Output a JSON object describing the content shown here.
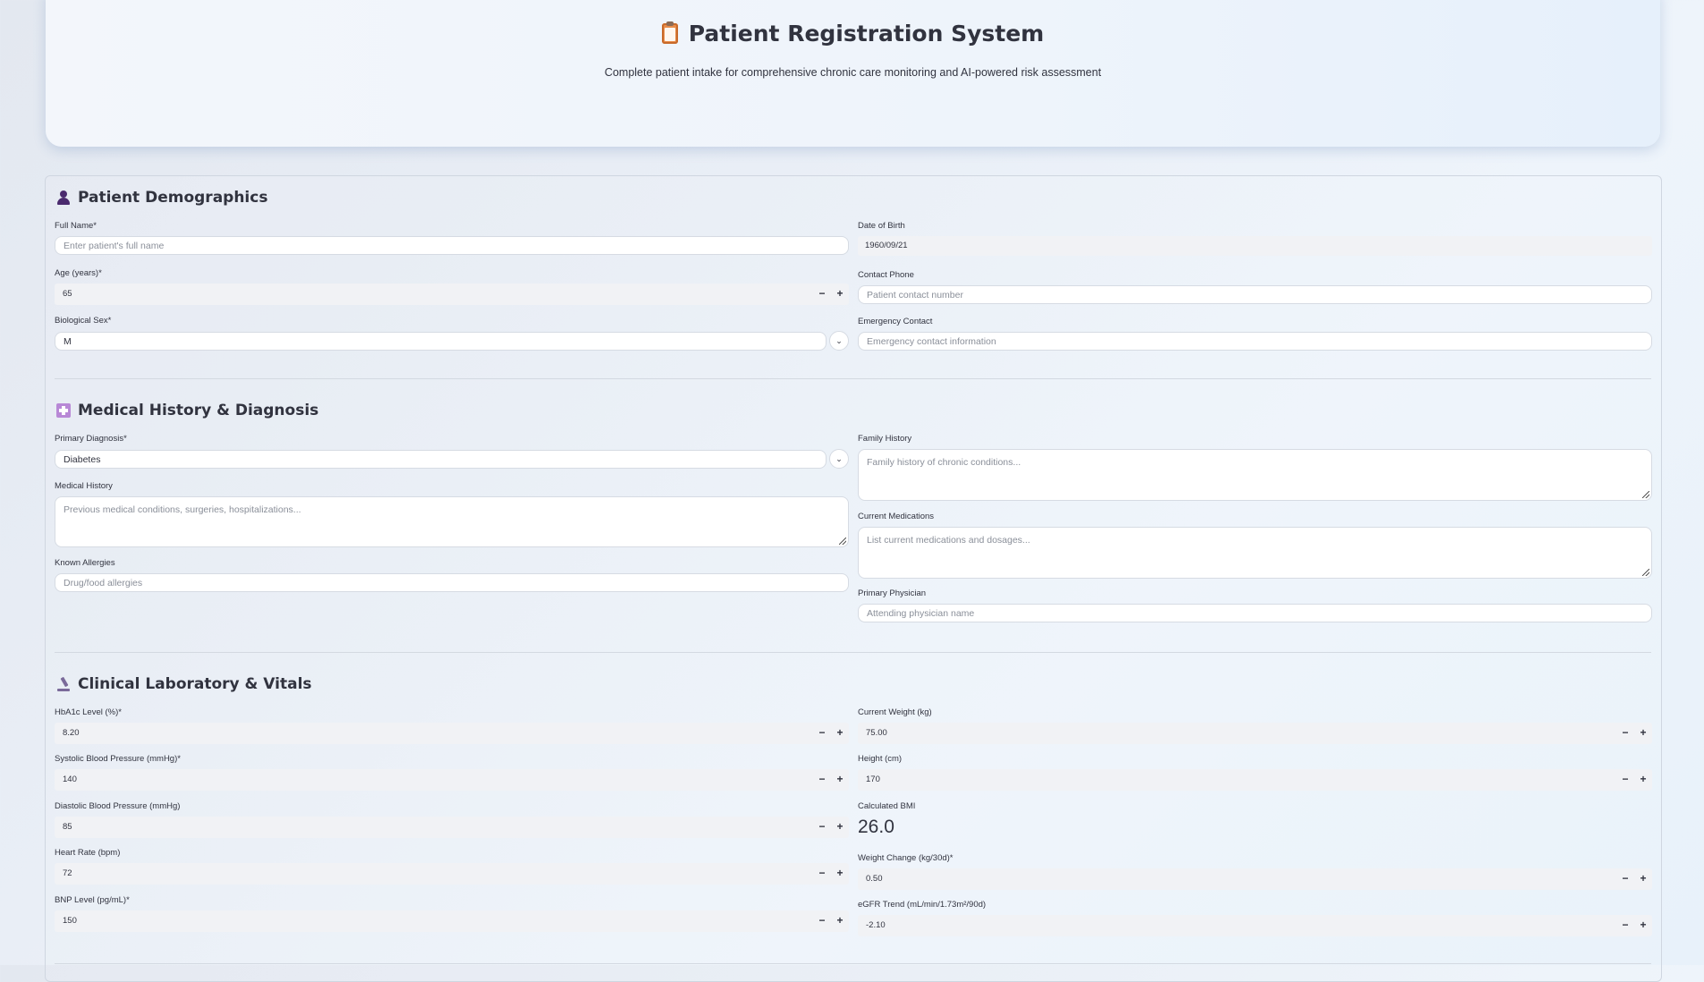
{
  "header": {
    "title": "Patient Registration System",
    "subtitle": "Complete patient intake for comprehensive chronic care monitoring and AI-powered risk assessment"
  },
  "demographics": {
    "title": "Patient Demographics",
    "full_name": {
      "label": "Full Name*",
      "placeholder": "Enter patient's full name"
    },
    "dob": {
      "label": "Date of Birth",
      "value": "1960/09/21"
    },
    "age": {
      "label": "Age (years)*",
      "value": "65"
    },
    "phone": {
      "label": "Contact Phone",
      "placeholder": "Patient contact number"
    },
    "sex": {
      "label": "Biological Sex*",
      "value": "M"
    },
    "emergency": {
      "label": "Emergency Contact",
      "placeholder": "Emergency contact information"
    }
  },
  "history": {
    "title": "Medical History & Diagnosis",
    "primary_dx": {
      "label": "Primary Diagnosis*",
      "value": "Diabetes"
    },
    "family": {
      "label": "Family History",
      "placeholder": "Family history of chronic conditions..."
    },
    "medical": {
      "label": "Medical History",
      "placeholder": "Previous medical conditions, surgeries, hospitalizations..."
    },
    "medications": {
      "label": "Current Medications",
      "placeholder": "List current medications and dosages..."
    },
    "allergies": {
      "label": "Known Allergies",
      "placeholder": "Drug/food allergies"
    },
    "physician": {
      "label": "Primary Physician",
      "placeholder": "Attending physician name"
    }
  },
  "labs": {
    "title": "Clinical Laboratory & Vitals",
    "hba1c": {
      "label": "HbA1c Level (%)*",
      "value": "8.20"
    },
    "weight": {
      "label": "Current Weight (kg)",
      "value": "75.00"
    },
    "systolic": {
      "label": "Systolic Blood Pressure (mmHg)*",
      "value": "140"
    },
    "height": {
      "label": "Height (cm)",
      "value": "170"
    },
    "diastolic": {
      "label": "Diastolic Blood Pressure (mmHg)",
      "value": "85"
    },
    "bmi": {
      "label": "Calculated BMI",
      "value": "26.0"
    },
    "heart_rate": {
      "label": "Heart Rate (bpm)",
      "value": "72"
    },
    "weight_change": {
      "label": "Weight Change (kg/30d)*",
      "value": "0.50"
    },
    "bnp": {
      "label": "BNP Level (pg/mL)*",
      "value": "150"
    },
    "egfr": {
      "label": "eGFR Trend (mL/min/1.73m²/90d)",
      "value": "-2.10"
    }
  },
  "stepper": {
    "minus": "−",
    "plus": "+"
  },
  "icons": {
    "header": "clipboard-icon",
    "demographics": "person-icon",
    "history": "hospital-icon",
    "labs": "microscope-icon",
    "select": "chevron-down-icon"
  }
}
